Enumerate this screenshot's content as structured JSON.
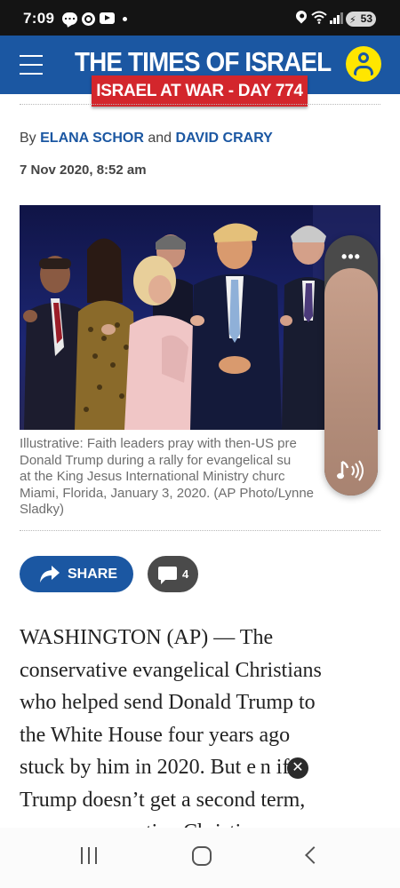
{
  "status_bar": {
    "time": "7:09",
    "battery": "53",
    "icons": [
      "message-icon",
      "chrome-icon",
      "youtube-icon",
      "dot-icon",
      "location-icon",
      "wifi-icon",
      "signal-icon",
      "battery-icon"
    ]
  },
  "header": {
    "title": "THE TIMES OF ISRAEL",
    "banner": "ISRAEL AT WAR - DAY 774",
    "colors": {
      "header_bg": "#1b57a2",
      "banner_bg": "#d3262c",
      "account_icon": "#ffe600"
    }
  },
  "byline": {
    "prefix": "By",
    "author1": "ELANA SCHOR",
    "conjunction": "and",
    "author2": "DAVID CRARY",
    "date": "7 Nov 2020, 8:52 am"
  },
  "photo": {
    "caption": "Illustrative: Faith leaders pray with then-US pre… Donald Trump during a rally for evangelical su…s at the King Jesus International Ministry church… Miami, Florida, January 3, 2020. (AP Photo/Lynne Sladky)",
    "caption_lines": [
      "Illustrative: Faith leaders pray with then-US pre",
      "Donald Trump during a rally for evangelical su",
      "at the King Jesus International Ministry churc",
      "Miami, Florida, January 3, 2020. (AP Photo/Lynne",
      "Sladky)"
    ]
  },
  "audio_widget": {
    "more_label": "•••"
  },
  "actions": {
    "share_label": "SHARE",
    "comment_count": "4"
  },
  "article": {
    "lines": [
      "WASHINGTON (AP) — The",
      "conservative evangelical Christians",
      "who helped send Donald Trump to",
      "the White House four years ago",
      "stuck by him in 2020. But e n if",
      "Trump doesn’t get a second term,",
      "some conservative Christians see"
    ]
  },
  "nav_bar": {
    "buttons": [
      "recents-button",
      "home-button",
      "back-button"
    ]
  }
}
